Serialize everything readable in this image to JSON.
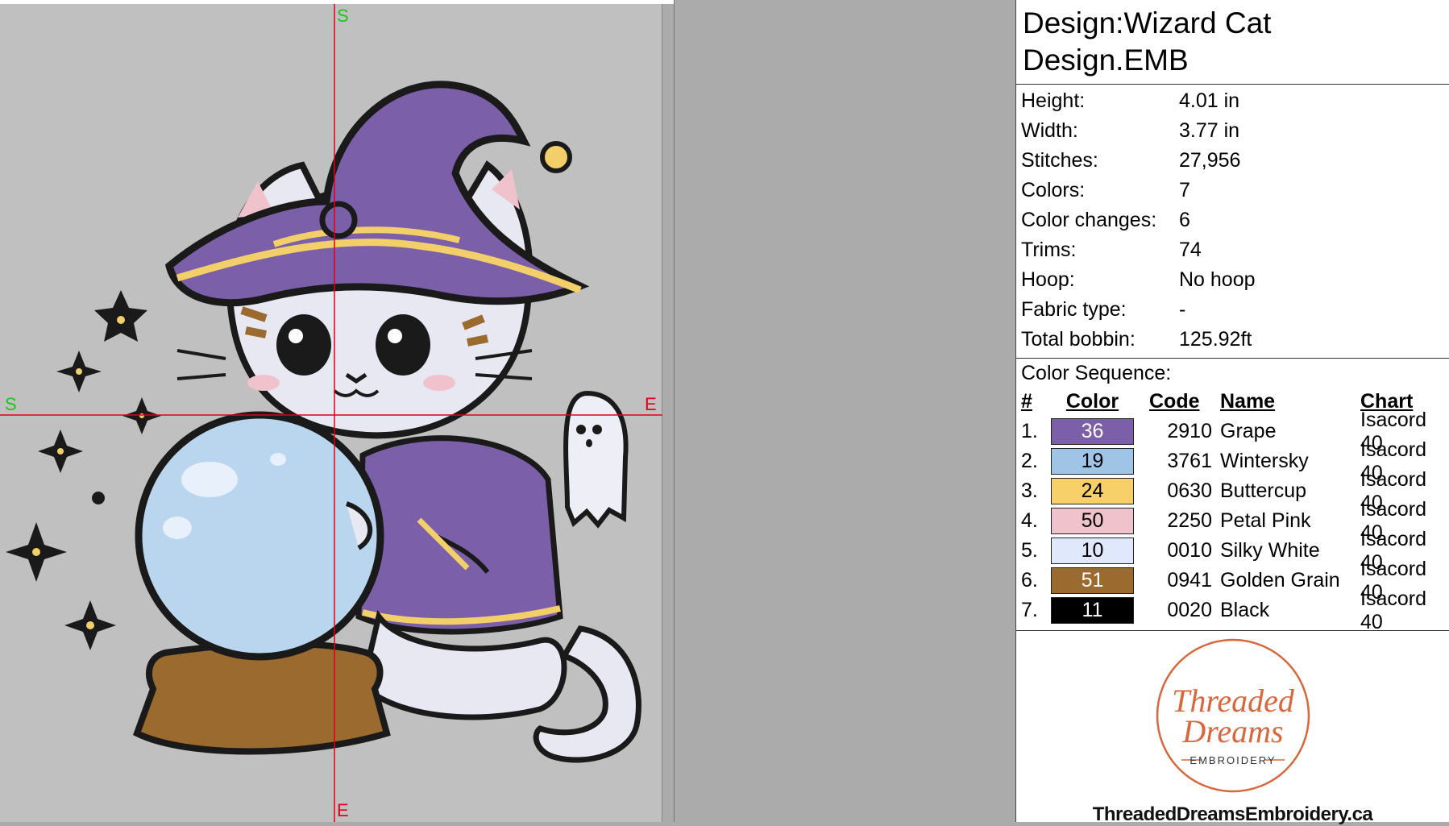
{
  "design": {
    "title_line1": "Design:Wizard Cat",
    "title_line2": "Design.EMB"
  },
  "properties": [
    {
      "key": "Height:",
      "value": "4.01 in"
    },
    {
      "key": "Width:",
      "value": "3.77 in"
    },
    {
      "key": "Stitches:",
      "value": "27,956"
    },
    {
      "key": "Colors:",
      "value": "7"
    },
    {
      "key": "Color changes:",
      "value": "6"
    },
    {
      "key": "Trims:",
      "value": "74"
    },
    {
      "key": "Hoop:",
      "value": "No hoop"
    },
    {
      "key": "Fabric type:",
      "value": "-"
    },
    {
      "key": "Total bobbin:",
      "value": "125.92ft"
    }
  ],
  "sequence": {
    "title": "Color Sequence:",
    "headers": {
      "num": "#",
      "color": "Color",
      "code": "Code",
      "name": "Name",
      "chart": "Chart"
    },
    "rows": [
      {
        "num": "1.",
        "swatch": "36",
        "hex": "#7b5fa8",
        "text": "#ffffff",
        "code": "2910",
        "name": "Grape",
        "chart": "Isacord 40"
      },
      {
        "num": "2.",
        "swatch": "19",
        "hex": "#9fc4e6",
        "text": "#000000",
        "code": "3761",
        "name": "Wintersky",
        "chart": "Isacord 40"
      },
      {
        "num": "3.",
        "swatch": "24",
        "hex": "#f8d06a",
        "text": "#000000",
        "code": "0630",
        "name": "Buttercup",
        "chart": "Isacord 40"
      },
      {
        "num": "4.",
        "swatch": "50",
        "hex": "#f0c2cc",
        "text": "#000000",
        "code": "2250",
        "name": "Petal Pink",
        "chart": "Isacord 40"
      },
      {
        "num": "5.",
        "swatch": "10",
        "hex": "#e0e8fb",
        "text": "#000000",
        "code": "0010",
        "name": "Silky White",
        "chart": "Isacord 40"
      },
      {
        "num": "6.",
        "swatch": "51",
        "hex": "#9b6a2e",
        "text": "#ffffff",
        "code": "0941",
        "name": "Golden Grain",
        "chart": "Isacord 40"
      },
      {
        "num": "7.",
        "swatch": "11",
        "hex": "#000000",
        "text": "#ffffff",
        "code": "0020",
        "name": "Black",
        "chart": "Isacord 40"
      }
    ]
  },
  "canvas": {
    "axis_top": "S",
    "axis_bottom": "E",
    "axis_left": "S",
    "axis_right": "E",
    "crosshair_color": "#e0001a",
    "label_start_color": "#19c619",
    "label_end_color": "#e0001a"
  },
  "logo": {
    "line1": "Threaded",
    "line2": "Dreams",
    "line3": "EMBROIDERY",
    "url": "ThreadedDreamsEmbroidery.ca",
    "accent": "#d9673b"
  }
}
